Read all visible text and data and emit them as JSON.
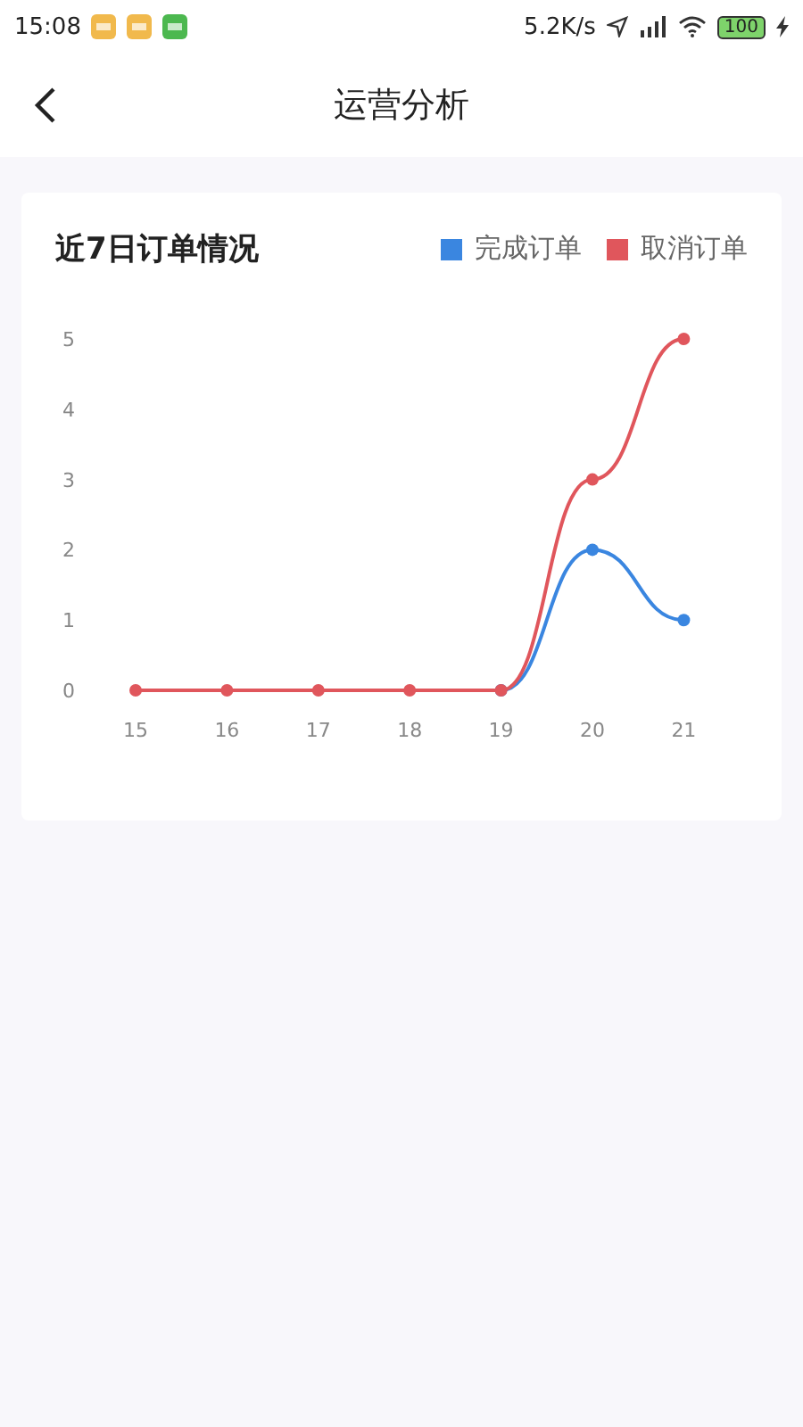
{
  "status_bar": {
    "time": "15:08",
    "speed": "5.2K/s",
    "battery": "100"
  },
  "header": {
    "title": "运营分析"
  },
  "card": {
    "chart_data": {
      "type": "line",
      "title": "近7日订单情况",
      "categories": [
        "15",
        "16",
        "17",
        "18",
        "19",
        "20",
        "21"
      ],
      "ylim": [
        0,
        5
      ],
      "yticks": [
        0,
        1,
        2,
        3,
        4,
        5
      ],
      "series": [
        {
          "name": "完成订单",
          "color": "#3a86e0",
          "marker": "circle",
          "values": [
            null,
            null,
            null,
            null,
            0,
            2,
            1
          ]
        },
        {
          "name": "取消订单",
          "color": "#e0565c",
          "marker": "circle",
          "values": [
            0,
            0,
            0,
            0,
            0,
            3,
            5
          ]
        }
      ]
    }
  }
}
